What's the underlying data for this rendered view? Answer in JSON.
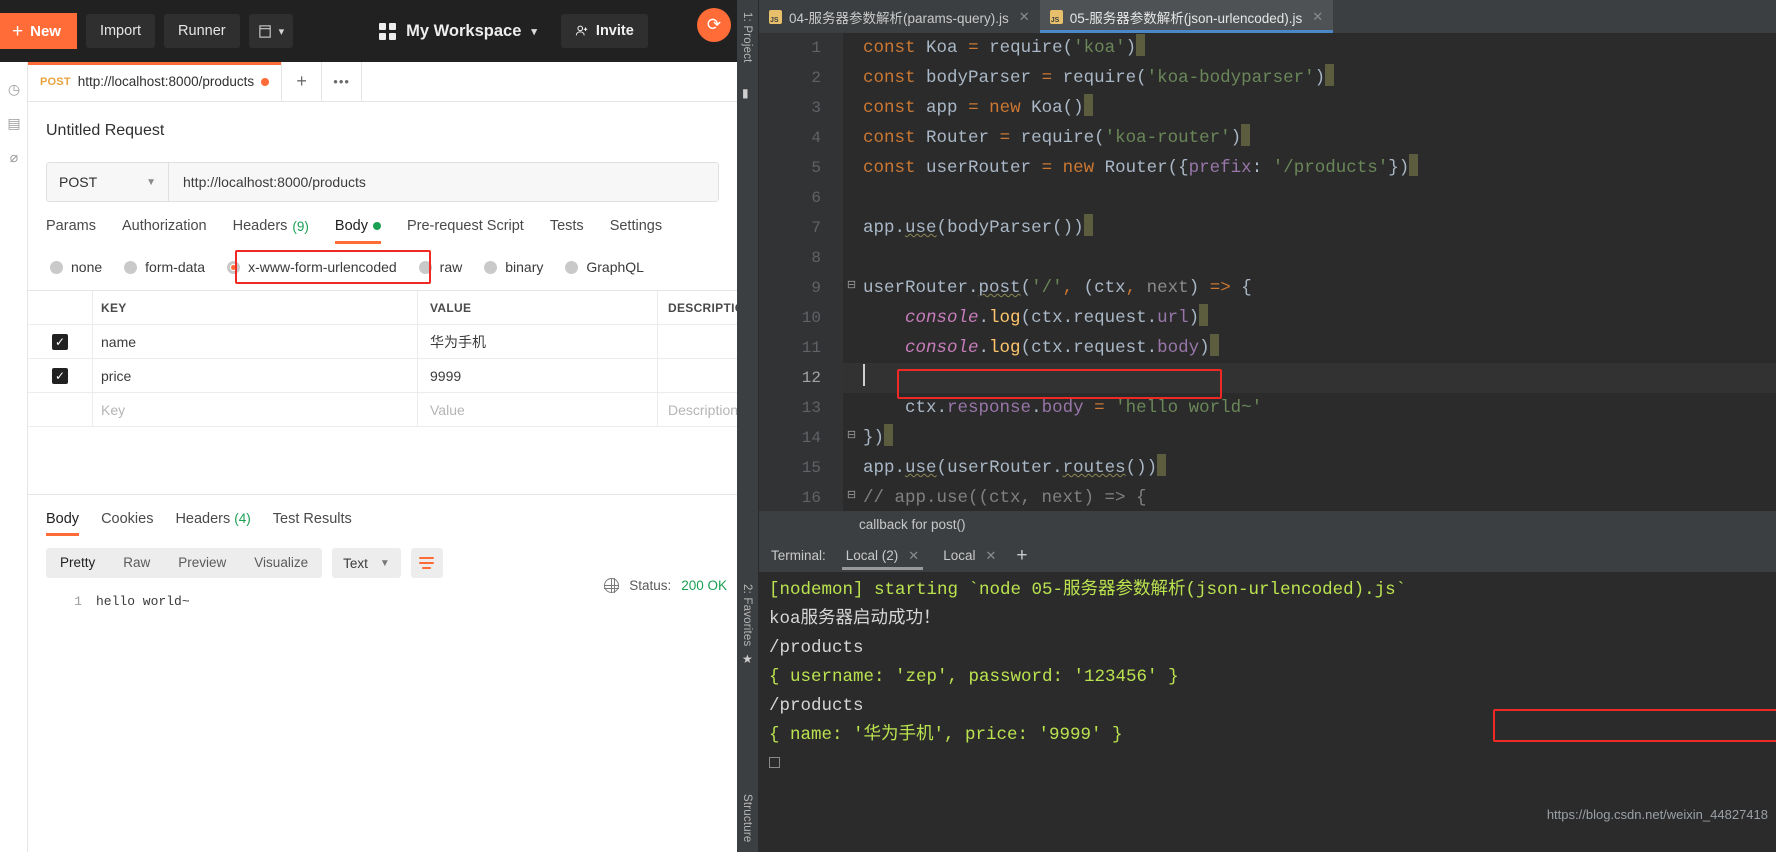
{
  "postman": {
    "topbar": {
      "new_label": "New",
      "import_label": "Import",
      "runner_label": "Runner",
      "workspace_label": "My Workspace",
      "invite_label": "Invite"
    },
    "request_tab": {
      "method": "POST",
      "url": "http://localhost:8000/products"
    },
    "request_title": "Untitled Request",
    "url_bar": {
      "method": "POST",
      "url": "http://localhost:8000/products"
    },
    "request_tabs": [
      {
        "label": "Params",
        "active": false
      },
      {
        "label": "Authorization",
        "active": false
      },
      {
        "label": "Headers",
        "count": "(9)",
        "active": false
      },
      {
        "label": "Body",
        "active": true
      },
      {
        "label": "Pre-request Script",
        "active": false
      },
      {
        "label": "Tests",
        "active": false
      },
      {
        "label": "Settings",
        "active": false
      }
    ],
    "body_types": [
      {
        "label": "none",
        "selected": false
      },
      {
        "label": "form-data",
        "selected": false
      },
      {
        "label": "x-www-form-urlencoded",
        "selected": true
      },
      {
        "label": "raw",
        "selected": false
      },
      {
        "label": "binary",
        "selected": false
      },
      {
        "label": "GraphQL",
        "selected": false
      }
    ],
    "kv_headers": {
      "key": "KEY",
      "value": "VALUE",
      "description": "DESCRIPTION"
    },
    "kv_rows": [
      {
        "checked": true,
        "key": "name",
        "value": "华为手机",
        "description": ""
      },
      {
        "checked": true,
        "key": "price",
        "value": "9999",
        "description": ""
      },
      {
        "checked": false,
        "key": "Key",
        "value": "Value",
        "description": "Description",
        "placeholder": true
      }
    ],
    "response_tabs": [
      {
        "label": "Body",
        "active": true
      },
      {
        "label": "Cookies",
        "active": false
      },
      {
        "label": "Headers",
        "count": "(4)",
        "active": false
      },
      {
        "label": "Test Results",
        "active": false
      }
    ],
    "status_label": "Status:",
    "status_value": "200 OK",
    "format_tabs": [
      {
        "label": "Pretty",
        "active": true
      },
      {
        "label": "Raw",
        "active": false
      },
      {
        "label": "Preview",
        "active": false
      },
      {
        "label": "Visualize",
        "active": false
      }
    ],
    "format_select": "Text",
    "response_line_no": "1",
    "response_body": "hello world~",
    "accent_color": "#ff6c37"
  },
  "ide": {
    "rails": {
      "project": "1: Project",
      "favorites": "2: Favorites",
      "structure": "Structure"
    },
    "file_tabs": [
      {
        "label": "04-服务器参数解析(params-query).js",
        "active": false
      },
      {
        "label": "05-服务器参数解析(json-urlencoded).js",
        "active": true
      }
    ],
    "code_lines": [
      {
        "n": "1",
        "text": "const Koa = require('koa')"
      },
      {
        "n": "2",
        "text": "const bodyParser = require('koa-bodyparser')"
      },
      {
        "n": "3",
        "text": "const app = new Koa()"
      },
      {
        "n": "4",
        "text": "const Router = require('koa-router')"
      },
      {
        "n": "5",
        "text": "const userRouter = new Router({prefix: '/products'})"
      },
      {
        "n": "6",
        "text": ""
      },
      {
        "n": "7",
        "text": "app.use(bodyParser())"
      },
      {
        "n": "8",
        "text": ""
      },
      {
        "n": "9",
        "text": "userRouter.post('/', (ctx, next) => {"
      },
      {
        "n": "10",
        "text": "    console.log(ctx.request.url)"
      },
      {
        "n": "11",
        "text": "    console.log(ctx.request.body)"
      },
      {
        "n": "12",
        "text": ""
      },
      {
        "n": "13",
        "text": "    ctx.response.body = 'hello world~'"
      },
      {
        "n": "14",
        "text": "})"
      },
      {
        "n": "15",
        "text": "app.use(userRouter.routes())"
      },
      {
        "n": "16",
        "text": "// app.use((ctx, next) => {"
      }
    ],
    "breadcrumb": "callback for post()",
    "terminal": {
      "label": "Terminal:",
      "tabs": [
        {
          "label": "Local (2)",
          "active": true
        },
        {
          "label": "Local",
          "active": false
        }
      ],
      "add_label": "+",
      "lines": [
        "[nodemon] starting `node 05-服务器参数解析(json-urlencoded).js`",
        "koa服务器启动成功！",
        "/products",
        "{ username: 'zep', password: '123456' }",
        "/products",
        "{ name: '华为手机', price: '9999' }"
      ]
    },
    "highlight_color": "#ef2a24"
  },
  "watermark": "https://blog.csdn.net/weixin_44827418"
}
